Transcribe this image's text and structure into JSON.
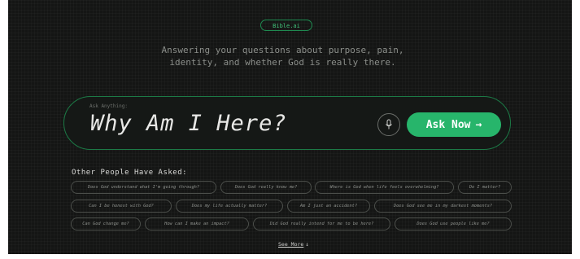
{
  "brand": {
    "badge": "Bible.ai"
  },
  "tagline": {
    "line1": "Answering your questions about purpose, pain,",
    "line2": "identity, and whether God is really there."
  },
  "ask": {
    "label": "Ask Anything:",
    "question": "Why Am I Here?",
    "button_label": "Ask Now",
    "button_arrow": "→",
    "mic_icon": "microphone-icon"
  },
  "others": {
    "title": "Other People Have Asked:",
    "rows": [
      [
        "Does God understand what I'm going through?",
        "Does God really know me?",
        "Where is God when life feels overwhelming?",
        "Do I matter?"
      ],
      [
        "Can I be honest with God?",
        "Does my life actually matter?",
        "Am I just an accident?",
        "Does God see me in my darkest moments?"
      ],
      [
        "Can God change me?",
        "How can I make an impact?",
        "Did God really intend for me to be here?",
        "Does God use people like me?"
      ]
    ]
  },
  "see_more": {
    "label": "See More",
    "arrow": "↓"
  },
  "colors": {
    "background": "#141514",
    "accent": "#27b56b",
    "accent_border": "#1c7a46"
  }
}
